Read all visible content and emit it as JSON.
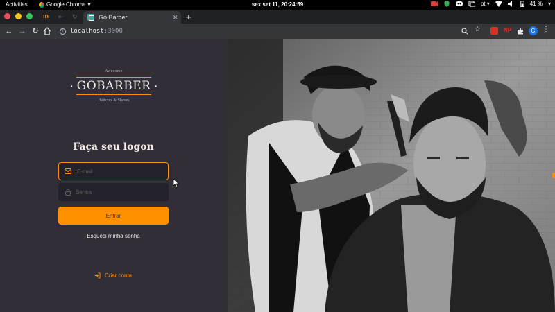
{
  "os_bar": {
    "activities": "Activities",
    "app_name": "Google Chrome",
    "clock": "sex set 11, 20:24:59",
    "lang": "pt",
    "battery": "41 %"
  },
  "browser": {
    "tab_title": "Go Barber",
    "url_host": "localhost",
    "url_port": ":3000",
    "ext_np": "NP",
    "profile_initial": "G"
  },
  "logo": {
    "top": "Awesome",
    "brand": "GOBARBER",
    "tagline": "Haircuts & Shaves"
  },
  "login": {
    "heading": "Faça seu logon",
    "email_placeholder": "E-mail",
    "password_placeholder": "Senha",
    "submit_label": "Entrar",
    "forgot_label": "Esqueci minha senha",
    "create_account_label": "Criar conta"
  },
  "colors": {
    "accent": "#ff9000",
    "background": "#312e38",
    "input_bg": "#232129"
  }
}
